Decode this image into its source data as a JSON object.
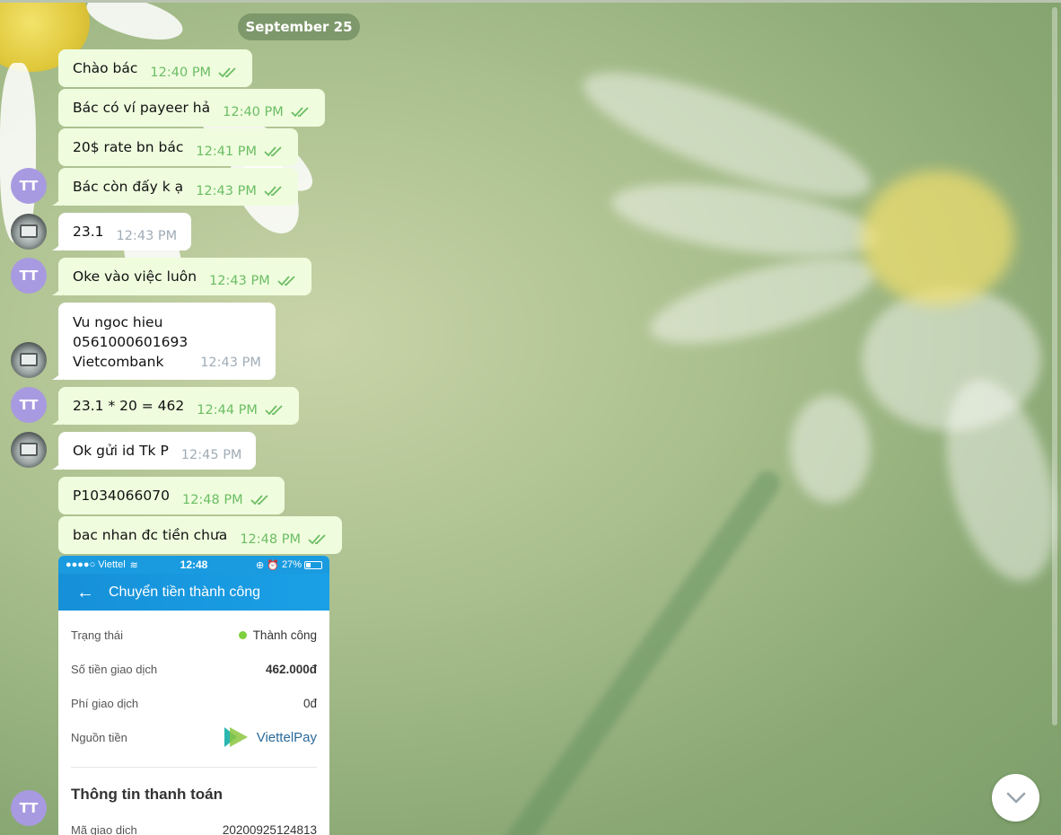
{
  "date_separator": "September 25",
  "avatar_initials": "TT",
  "messages": [
    {
      "text": "Chào bác",
      "time": "12:40 PM"
    },
    {
      "text": "Bác có ví payeer hả",
      "time": "12:40 PM"
    },
    {
      "text": "20$ rate bn bác",
      "time": "12:41 PM"
    },
    {
      "text": "Bác còn đấy k ạ",
      "time": "12:43 PM"
    },
    {
      "text": "23.1",
      "time": "12:43 PM"
    },
    {
      "text": "Oke vào việc luôn",
      "time": "12:43 PM"
    },
    {
      "lines": [
        "Vu ngoc hieu",
        "0561000601693",
        "Vietcombank"
      ],
      "time": "12:43 PM"
    },
    {
      "text": "23.1 * 20 = 462",
      "time": "12:44 PM"
    },
    {
      "text": "Ok gửi id Tk  P",
      "time": "12:45 PM"
    },
    {
      "text": "P1034066070",
      "time": "12:48 PM"
    },
    {
      "text": "bac nhan đc tiền chưa",
      "time": "12:48 PM"
    }
  ],
  "screenshot": {
    "carrier": "●●●●○ Viettel",
    "clock": "12:48",
    "battery": "27%",
    "header_title": "Chuyển tiền thành công",
    "rows": [
      {
        "label": "Trạng thái",
        "value": "Thành công"
      },
      {
        "label": "Số tiền giao dịch",
        "value": "462.000đ"
      },
      {
        "label": "Phí giao dịch",
        "value": "0đ"
      },
      {
        "label": "Nguồn tiền",
        "value": "ViettelPay"
      }
    ],
    "section_title": "Thông tin thanh toán",
    "txn_label": "Mã giao dịch",
    "txn_value": "20200925124813"
  },
  "colors": {
    "outgoing_bubble": "#effdde",
    "incoming_bubble": "#ffffff",
    "outgoing_meta": "#6cbd64",
    "avatar": "#a89ae0"
  }
}
